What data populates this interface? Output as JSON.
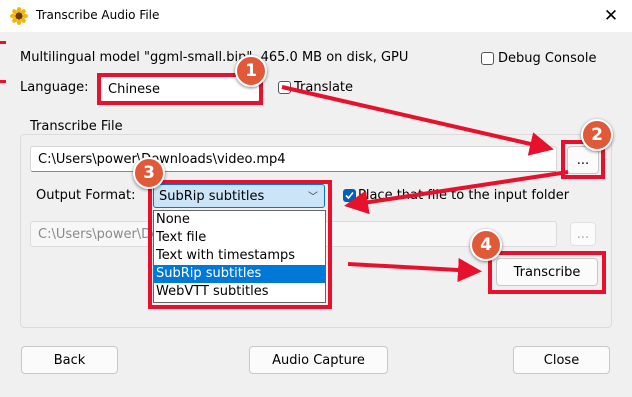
{
  "window": {
    "title": "Transcribe Audio File",
    "icon": "sunflower-icon",
    "close_glyph": "✕"
  },
  "model_info": "Multilingual model \"ggml-small.bin\", 465.0 MB on disk, GPU",
  "debug_console": {
    "label": "Debug Console",
    "checked": false
  },
  "language": {
    "label": "Language:",
    "value": "Chinese"
  },
  "translate": {
    "label": "Translate",
    "checked": false
  },
  "transcribe_group": {
    "title": "Transcribe File"
  },
  "file_path": {
    "value": "C:\\Users\\power\\Downloads\\video.mp4"
  },
  "browse_button": {
    "label": "..."
  },
  "output_format": {
    "label": "Output Format:",
    "value": "SubRip subtitles",
    "options": [
      "None",
      "Text file",
      "Text with timestamps",
      "SubRip subtitles",
      "WebVTT subtitles"
    ],
    "selected_index": 3
  },
  "place_checkbox": {
    "label": "Place that file to the input folder",
    "checked": true
  },
  "output_path": {
    "value": "C:\\Users\\power\\Downloads\\video.srt"
  },
  "output_browse_button": {
    "label": "..."
  },
  "transcribe_button": {
    "label": "Transcribe"
  },
  "footer": {
    "back": "Back",
    "audio_capture": "Audio Capture",
    "close": "Close"
  },
  "annotations": {
    "colors": {
      "box": "#e8112d",
      "badge": "#e05a3a"
    },
    "badges": [
      "1",
      "2",
      "3",
      "4"
    ]
  }
}
